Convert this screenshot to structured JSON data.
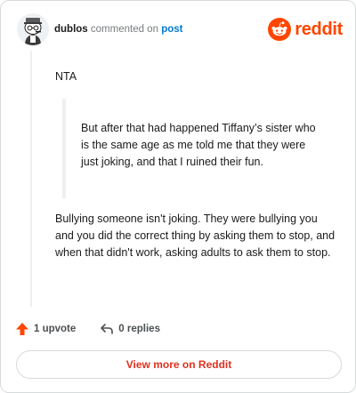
{
  "header": {
    "username": "dublos",
    "action_text": "commented on",
    "post_link": "post",
    "brand": "reddit"
  },
  "comment": {
    "first_line": "NTA",
    "quote": "But after that had happened Tiffany’s sister who is the same age as me told me that they were just joking, and that I ruined their fun.",
    "paragraph": "Bullying someone isn't joking. They were bullying you and you did the correct thing by asking them to stop, and when that didn't work, asking adults to ask them to stop."
  },
  "actions": {
    "upvote_label": "1 upvote",
    "replies_label": "0 replies"
  },
  "cta": {
    "label": "View more on Reddit"
  },
  "colors": {
    "brand": "#ff4500",
    "link": "#0079d3",
    "upvote": "#ff4500",
    "cta_text": "#e0301e"
  },
  "icons": {
    "avatar": "snoo-avatar-icon",
    "logo": "reddit-logo-icon",
    "upvote": "upvote-arrow-icon",
    "reply": "reply-arrow-icon"
  }
}
